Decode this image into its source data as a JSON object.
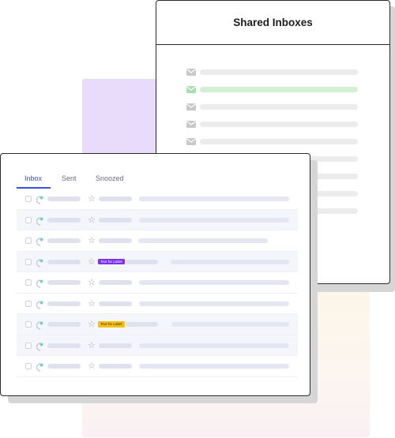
{
  "shared_inboxes": {
    "title": "Shared Inboxes",
    "accent_row_color": "#d3f0d6",
    "default_row_color": "#ececec",
    "icons": [
      "envelope-icon"
    ]
  },
  "inbox": {
    "tabs": [
      {
        "label": "Inbox",
        "active": true
      },
      {
        "label": "Sent",
        "active": false
      },
      {
        "label": "Snoozed",
        "active": false
      }
    ],
    "accent_color": "#3b4ee0",
    "labels": [
      {
        "text": "Text for Label",
        "bg": "#7b2ff0",
        "color": "#ffffff"
      },
      {
        "text": "Text for Label",
        "bg": "#f2c21b",
        "color": "#3a2a00"
      }
    ]
  }
}
